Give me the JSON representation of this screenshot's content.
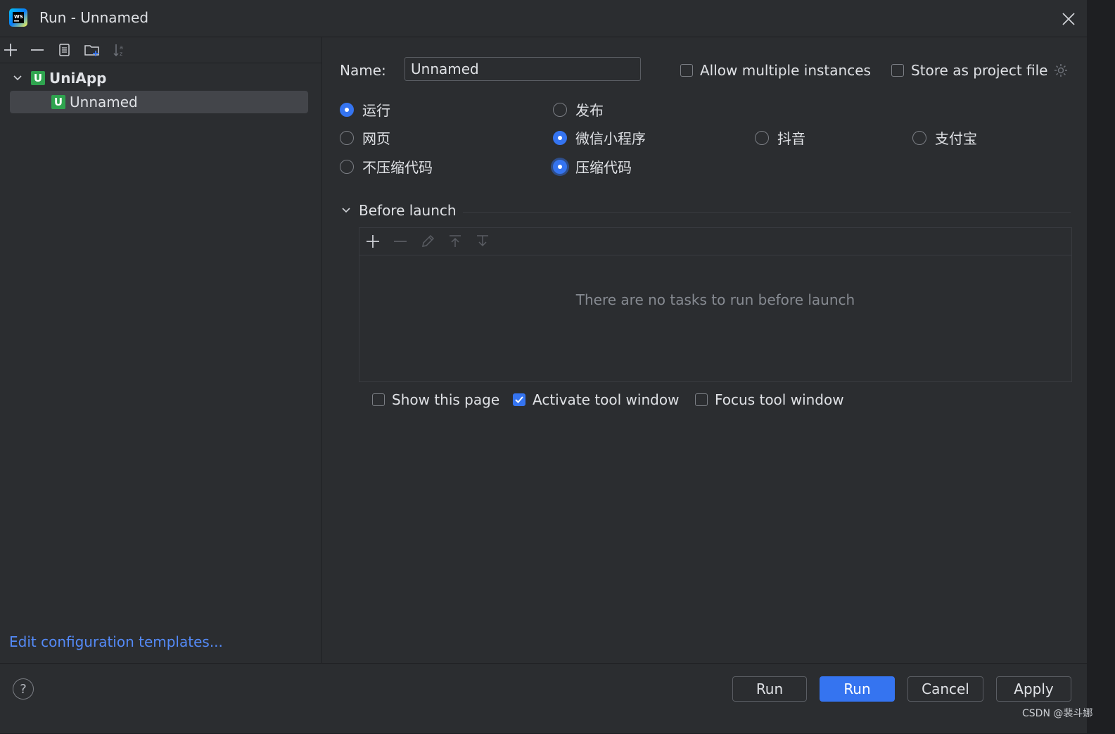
{
  "window": {
    "title": "Run - Unnamed"
  },
  "left_panel": {
    "tree": {
      "group_label": "UniApp",
      "item_label": "Unnamed"
    },
    "templates_link": "Edit configuration templates..."
  },
  "form": {
    "name_label": "Name:",
    "name_value": "Unnamed",
    "allow_multiple_label": "Allow multiple instances",
    "store_project_label": "Store as project file",
    "radios": {
      "run": "运行",
      "publish": "发布",
      "web": "网页",
      "wechat": "微信小程序",
      "douyin": "抖音",
      "alipay": "支付宝",
      "no_compress": "不压缩代码",
      "compress": "压缩代码"
    }
  },
  "before_launch": {
    "title": "Before launch",
    "empty_text": "There are no tasks to run before launch",
    "show_page_label": "Show this page",
    "activate_label": "Activate tool window",
    "focus_label": "Focus tool window"
  },
  "footer": {
    "help": "?",
    "run_label": "Run",
    "run_primary_label": "Run",
    "cancel_label": "Cancel",
    "apply_label": "Apply"
  },
  "watermark": "CSDN @裴斗娜",
  "colors": {
    "accent": "#3574f0",
    "link": "#548af7",
    "background": "#2b2d30",
    "uniapp_green": "#2fa44f"
  }
}
